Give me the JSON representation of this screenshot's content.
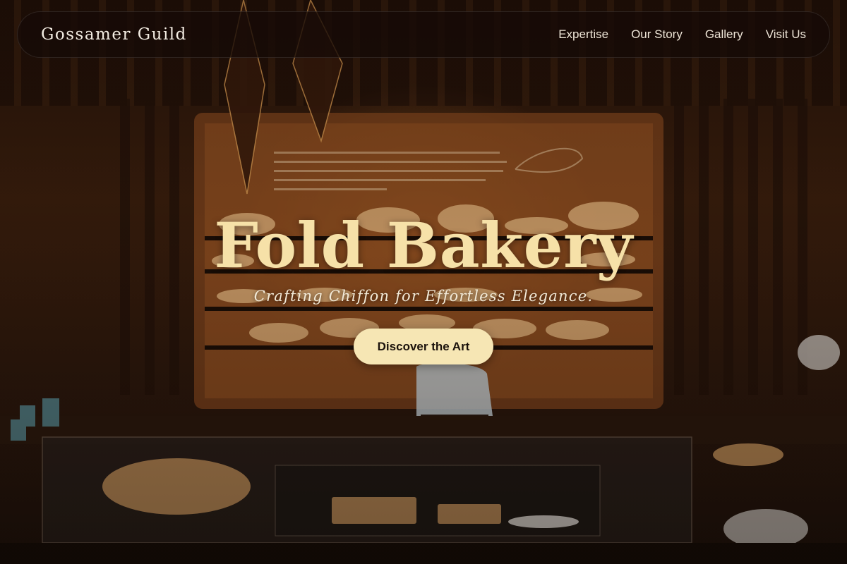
{
  "navbar": {
    "brand": "Gossamer Guild",
    "links": [
      {
        "label": "Expertise"
      },
      {
        "label": "Our Story"
      },
      {
        "label": "Gallery"
      },
      {
        "label": "Visit Us"
      }
    ]
  },
  "hero": {
    "title": "Fold Bakery",
    "subtitle": "Crafting Chiffon for Effortless Elegance.",
    "cta_label": "Discover the Art"
  },
  "colors": {
    "accent": "#f6e1a8",
    "button_bg": "#f6e6b4",
    "nav_bg": "#160a06"
  }
}
